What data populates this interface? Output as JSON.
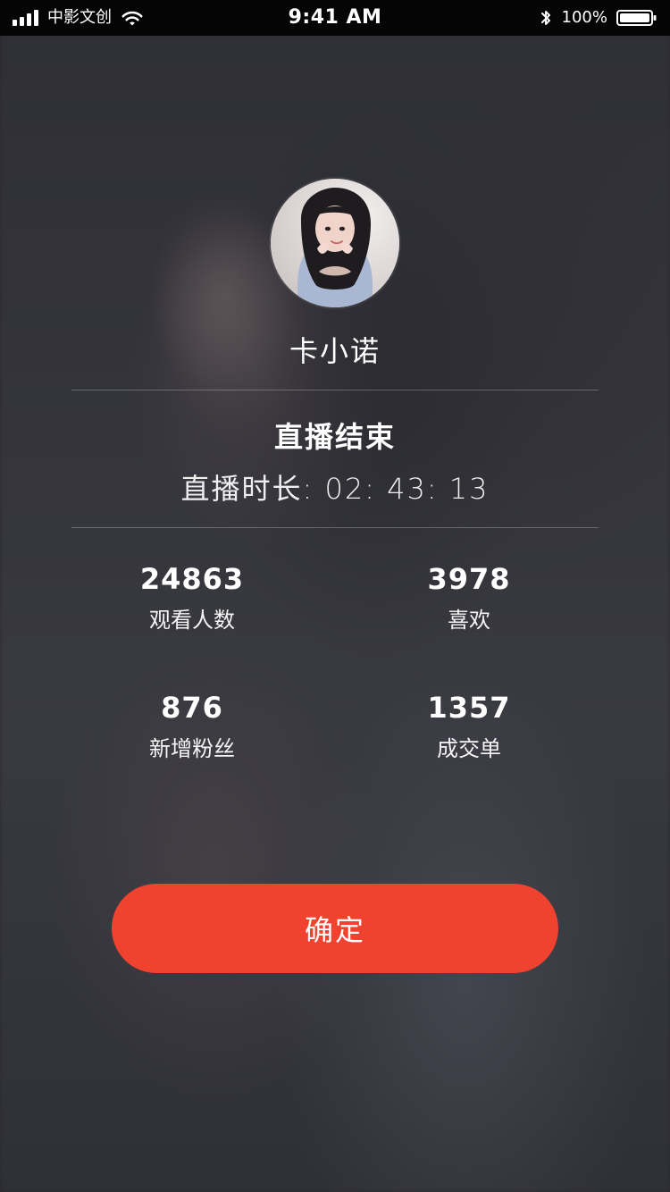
{
  "status_bar": {
    "carrier": "中影文创",
    "time": "9:41 AM",
    "battery": "100%"
  },
  "profile": {
    "name": "卡小诺"
  },
  "live": {
    "ended_title": "直播结束",
    "duration_label": "直播时长:",
    "duration_value": "02: 43: 13"
  },
  "stats": [
    {
      "value": "24863",
      "label": "观看人数"
    },
    {
      "value": "3978",
      "label": "喜欢"
    },
    {
      "value": "876",
      "label": "新增粉丝"
    },
    {
      "value": "1357",
      "label": "成交单"
    }
  ],
  "actions": {
    "confirm_label": "确定"
  },
  "colors": {
    "accent": "#f0432f",
    "status_bar_bg": "#050505"
  },
  "icons": {
    "signal": "signal-icon",
    "wifi": "wifi-icon",
    "bluetooth": "bluetooth-icon",
    "battery": "battery-icon",
    "avatar": "avatar"
  }
}
